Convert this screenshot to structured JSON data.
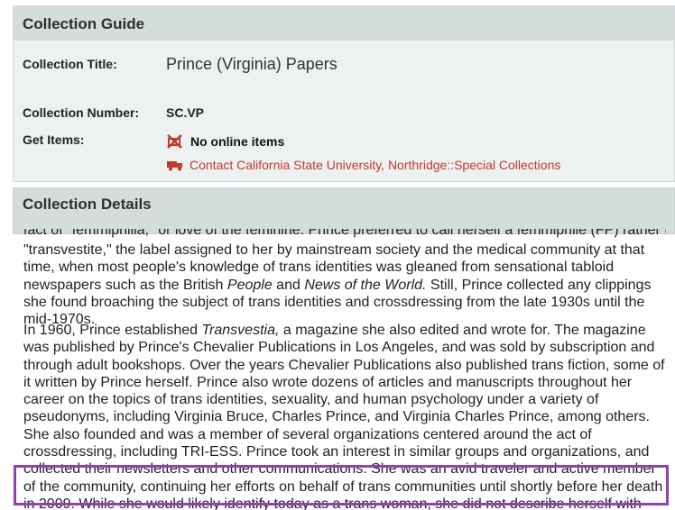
{
  "guide": {
    "header": "Collection Guide",
    "title_label": "Collection Title:",
    "title_value": "Prince (Virginia) Papers",
    "number_label": "Collection Number:",
    "number_value": "SC.VP",
    "get_items_label": "Get Items:",
    "no_online_items": "No online items",
    "contact_link": "Contact California State University, Northridge::Special Collections",
    "no_online_icon": "no-online-items-icon",
    "contact_icon": "truck-icon"
  },
  "details": {
    "header": "Collection Details"
  },
  "content": {
    "cut_line": "fact of \"femmiphilia,\" or love of the feminine. Prince preferred to call herself a femmiphile (FP) rather than a",
    "p1": {
      "a": "\"transvestite,\" the label assigned to her by mainstream society and the medical community at that time, when most people's knowledge of trans identities was gleaned from sensational tabloid newspapers such as the British ",
      "people": "People",
      "b": " and ",
      "news": "News of the World.",
      "c": " Still, Prince collected any clippings she found broaching the subject of trans identities and crossdressing from the late 1930s until the mid-1970s."
    },
    "p2": {
      "a": "In 1960, Prince established ",
      "transvestia": "Transvestia,",
      "b": " a magazine she also edited and wrote for. The magazine was published by Prince's Chevalier Publications in Los Angeles, and was sold by subscription and through adult bookshops. Over the years Chevalier Publications also published trans fiction, some of it written by Prince herself. Prince also wrote dozens of articles and manuscripts throughout her career on the topics of trans identities, sexuality, and human psychology under a variety of pseudonyms, including Virginia Bruce, Charles Prince, and Virginia Charles Prince, among others. She also founded and was a member of several organizations centered around the act of crossdressing, including TRI-ESS. Prince took an interest in similar groups and organizations, and collected their newsletters and other communications. She was an avid traveler and active member of the community, continuing her efforts on behalf of trans communities until shortly before her death in 2009. While she would likely identify today as a trans woman, she did not describe herself with those words during her life."
    }
  },
  "colors": {
    "header_bg": "#d4dcdc",
    "panel_bg": "#eef1f1",
    "link": "#c0392b",
    "highlight_border": "#8e44ad"
  }
}
